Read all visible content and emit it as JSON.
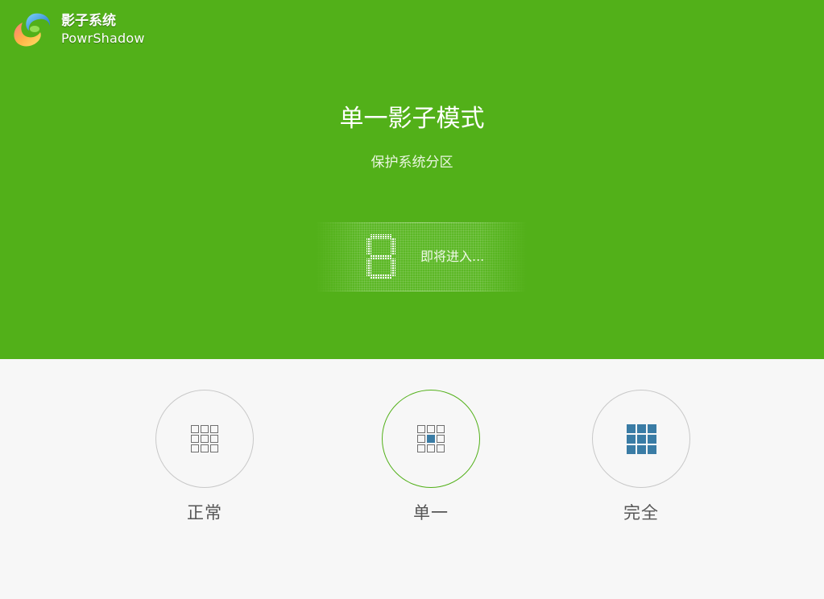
{
  "brand": {
    "name_cn": "影子系统",
    "name_en": "PowrShadow"
  },
  "current_mode": {
    "title": "单一影子模式",
    "subtitle": "保护系统分区"
  },
  "countdown": {
    "value": "8",
    "text": "即将进入..."
  },
  "modes": [
    {
      "label": "正常",
      "icon": "grid-outline-icon",
      "active": false
    },
    {
      "label": "单一",
      "icon": "grid-center-filled-icon",
      "active": true
    },
    {
      "label": "完全",
      "icon": "grid-full-filled-icon",
      "active": false
    }
  ],
  "colors": {
    "accent_green": "#52b019",
    "icon_blue": "#3a7ca5",
    "background": "#f7f7f7"
  }
}
